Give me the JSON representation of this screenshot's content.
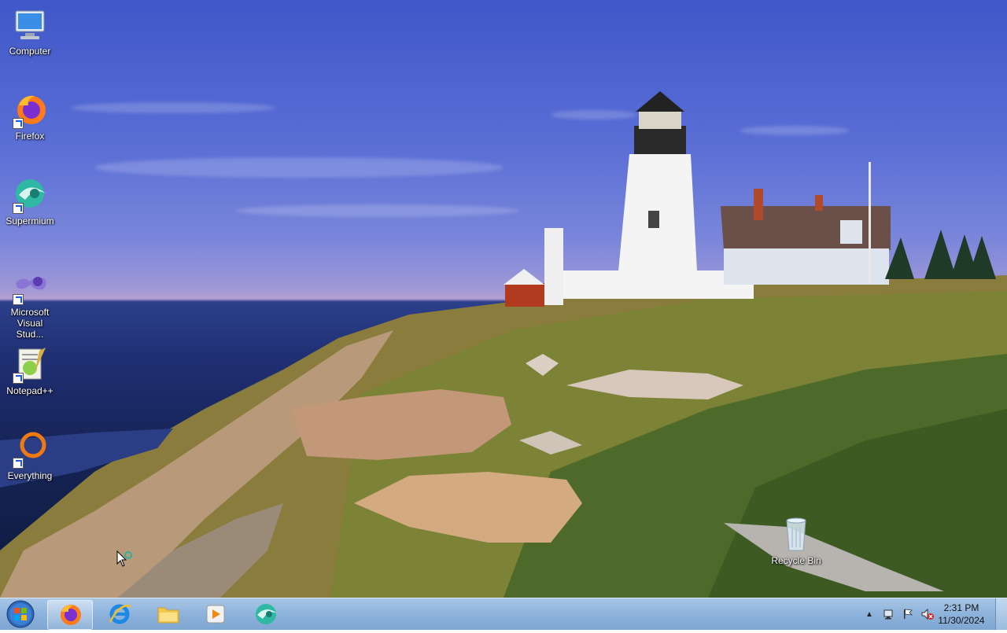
{
  "desktop": {
    "icons": [
      {
        "label": "Computer",
        "icon": "computer-icon",
        "shortcut": false
      },
      {
        "label": "Firefox",
        "icon": "firefox-icon",
        "shortcut": true
      },
      {
        "label": "Supermium",
        "icon": "supermium-icon",
        "shortcut": true
      },
      {
        "label": "Microsoft Visual Stud...",
        "icon": "visual-studio-icon",
        "shortcut": true
      },
      {
        "label": "Notepad++",
        "icon": "notepadpp-icon",
        "shortcut": true
      },
      {
        "label": "Everything",
        "icon": "everything-icon",
        "shortcut": true
      }
    ],
    "recycle_bin": {
      "label": "Recycle Bin",
      "icon": "recycle-bin-icon"
    }
  },
  "taskbar": {
    "pinned": [
      {
        "name": "firefox",
        "icon": "firefox-icon"
      },
      {
        "name": "internet-explorer",
        "icon": "internet-explorer-icon"
      },
      {
        "name": "file-explorer",
        "icon": "folder-icon"
      },
      {
        "name": "media-player",
        "icon": "media-player-icon"
      },
      {
        "name": "supermium",
        "icon": "supermium-icon"
      }
    ],
    "clock": {
      "time": "2:31 PM",
      "date": "11/30/2024"
    }
  },
  "colors": {
    "taskbar": "#8fb4dc",
    "sky": "#4b62cf",
    "sea": "#1f2f73",
    "grass": "#8a8a3a"
  }
}
